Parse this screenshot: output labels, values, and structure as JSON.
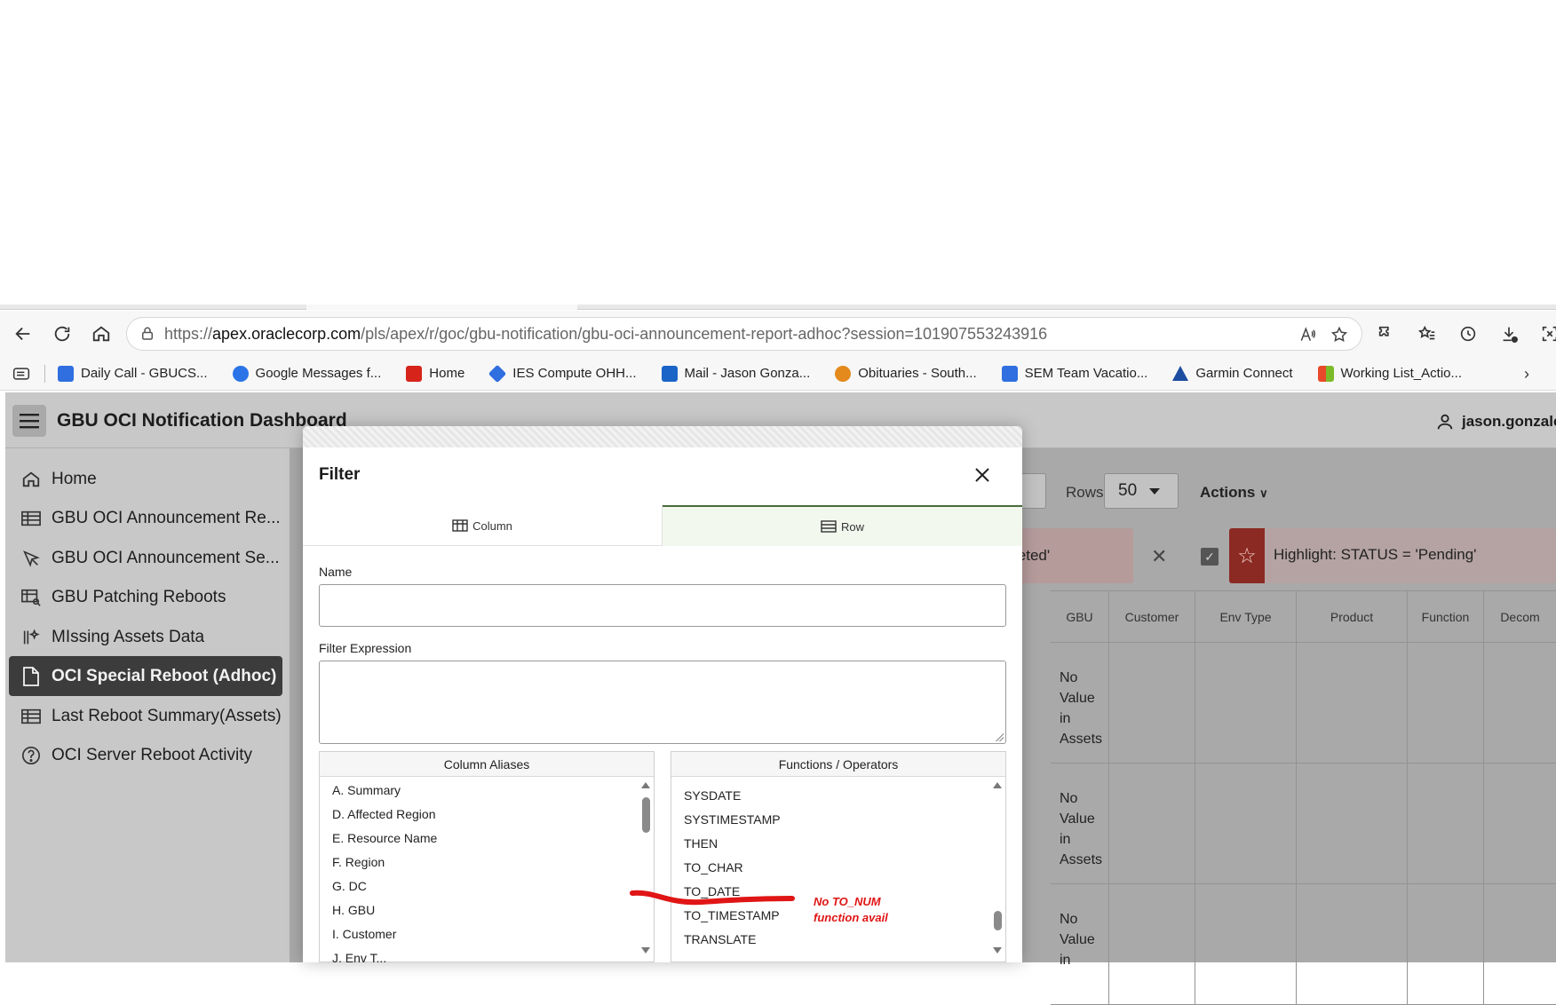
{
  "browser": {
    "url_prefix": "https://",
    "url_host": "apex.oraclecorp.com",
    "url_path": "/pls/apex/r/goc/gbu-notification/gbu-oci-announcement-report-adhoc?session=101907553243916",
    "bookmarks": [
      {
        "label": "Daily Call - GBUCS...",
        "color": "#2f6fe0"
      },
      {
        "label": "Google Messages f...",
        "color": "#2a74e8"
      },
      {
        "label": "Home",
        "color": "#d6241b"
      },
      {
        "label": "IES Compute OHH...",
        "color": "#2f6fe0"
      },
      {
        "label": "Mail - Jason Gonza...",
        "color": "#1a64c7"
      },
      {
        "label": "Obituaries - South...",
        "color": "#e48a1c"
      },
      {
        "label": "SEM Team Vacatio...",
        "color": "#2f6fe0"
      },
      {
        "label": "Garmin Connect",
        "color": "#1c4da0"
      },
      {
        "label": "Working List_Actio...",
        "color": "#e8492a"
      }
    ]
  },
  "app": {
    "title": "GBU OCI Notification Dashboard",
    "user": "jason.gonzalez",
    "nav": [
      {
        "label": "Home",
        "icon": "home-icon",
        "active": false
      },
      {
        "label": "GBU OCI Announcement Re...",
        "icon": "table-icon",
        "active": false
      },
      {
        "label": "GBU OCI Announcement Se...",
        "icon": "cursor-icon",
        "active": false
      },
      {
        "label": "GBU Patching Reboots",
        "icon": "table-search-icon",
        "active": false
      },
      {
        "label": "MIssing Assets Data",
        "icon": "sparkle-list-icon",
        "active": false
      },
      {
        "label": "OCI Special Reboot (Adhoc)",
        "icon": "file-icon",
        "active": true
      },
      {
        "label": "Last Reboot Summary(Assets)",
        "icon": "table-icon",
        "active": false
      },
      {
        "label": "OCI Server Reboot Activity",
        "icon": "help-circle-icon",
        "active": false
      }
    ]
  },
  "report": {
    "rows_label": "Rows",
    "rows_value": "50",
    "actions_label": "Actions",
    "filter_chip_text": "leted'",
    "highlight_text": "Highlight: STATUS = 'Pending'",
    "columns": [
      "GBU",
      "Customer",
      "Env Type",
      "Product",
      "Function",
      "Decom"
    ],
    "rows": [
      {
        "gbu": "No Value in Assets"
      },
      {
        "gbu": "No Value in Assets"
      },
      {
        "gbu": "No Value in"
      }
    ]
  },
  "modal": {
    "title": "Filter",
    "tab_column": "Column",
    "tab_row": "Row",
    "name_label": "Name",
    "expr_label": "Filter Expression",
    "aliases_header": "Column Aliases",
    "functions_header": "Functions / Operators",
    "aliases": [
      "A. Summary",
      "D. Affected Region",
      "E. Resource Name",
      "F. Region",
      "G. DC",
      "H. GBU",
      "I. Customer",
      "J. Env T..."
    ],
    "functions": [
      "SYSDATE",
      "SYSTIMESTAMP",
      "THEN",
      "TO_CHAR",
      "TO_DATE",
      "TO_TIMESTAMP",
      "TRANSLATE"
    ]
  },
  "annotation": {
    "line1": "No TO_NUM",
    "line2": "function avail",
    "color": "#e01515"
  }
}
